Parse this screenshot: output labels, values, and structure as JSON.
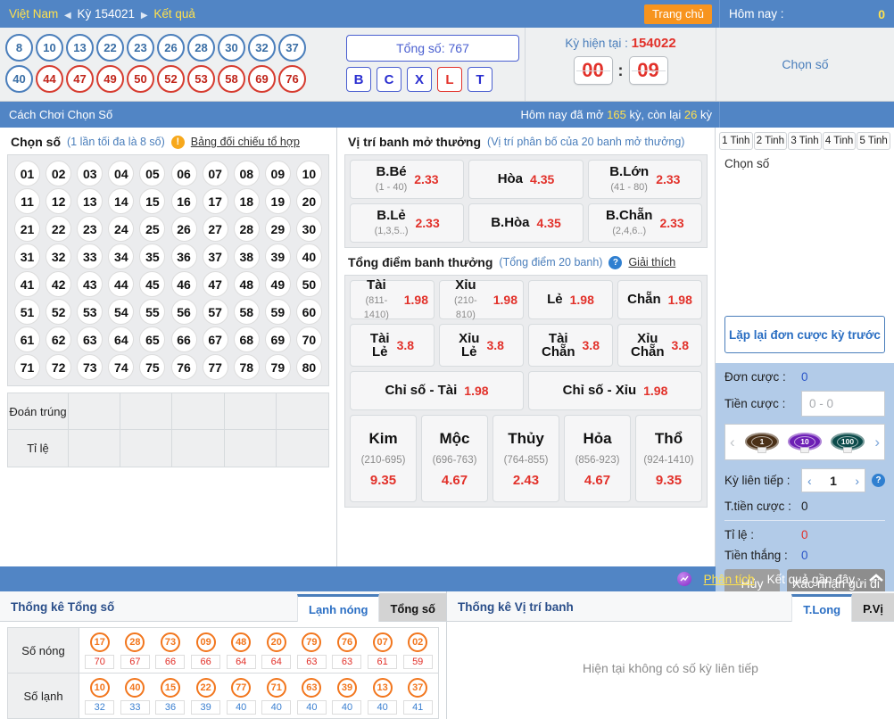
{
  "topbar": {
    "breadcrumb_country": "Việt Nam",
    "arrow_left": "◀",
    "breadcrumb_ky": "Kỳ 154021",
    "arrow_right": "▶",
    "breadcrumb_result": "Kết quả",
    "home_button": "Trang chủ",
    "today_label": "Hôm nay :",
    "today_value": "0"
  },
  "result": {
    "row1": [
      "8",
      "10",
      "13",
      "22",
      "23",
      "26",
      "28",
      "30",
      "32",
      "37"
    ],
    "row2": [
      "40",
      "44",
      "47",
      "49",
      "50",
      "52",
      "53",
      "58",
      "69",
      "76"
    ],
    "row2_red_from_index": 1,
    "total_label": "Tổng số: 767",
    "letters": [
      "B",
      "C",
      "X",
      "L",
      "T"
    ],
    "letter_red": "L",
    "ky_label": "Kỳ hiện tại :",
    "ky_value": "154022",
    "clock_minutes": "00",
    "clock_colon": ":",
    "clock_seconds": "09",
    "side_title": "Chọn số"
  },
  "subbar": {
    "how_to_play": "Cách Chơi Chọn Số",
    "opened_prefix": "Hôm nay đã mở",
    "opened_count": "165",
    "opened_mid": "kỳ, còn lại",
    "remain_count": "26",
    "opened_suffix": "kỳ"
  },
  "choose": {
    "title": "Chọn số",
    "subtitle": "(1 lần tối đa là 8 số)",
    "warn_icon": "!",
    "table_link": "Bảng đối chiếu tổ hợp",
    "numbers": [
      "01",
      "02",
      "03",
      "04",
      "05",
      "06",
      "07",
      "08",
      "09",
      "10",
      "11",
      "12",
      "13",
      "14",
      "15",
      "16",
      "17",
      "18",
      "19",
      "20",
      "21",
      "22",
      "23",
      "24",
      "25",
      "26",
      "27",
      "28",
      "29",
      "30",
      "31",
      "32",
      "33",
      "34",
      "35",
      "36",
      "37",
      "38",
      "39",
      "40",
      "41",
      "42",
      "43",
      "44",
      "45",
      "46",
      "47",
      "48",
      "49",
      "50",
      "51",
      "52",
      "53",
      "54",
      "55",
      "56",
      "57",
      "58",
      "59",
      "60",
      "61",
      "62",
      "63",
      "64",
      "65",
      "66",
      "67",
      "68",
      "69",
      "70",
      "71",
      "72",
      "73",
      "74",
      "75",
      "76",
      "77",
      "78",
      "79",
      "80"
    ],
    "ratio_row1_label": "Đoán trúng",
    "ratio_row2_label": "Tỉ lệ"
  },
  "position": {
    "title": "Vị trí banh mở thưởng",
    "subtitle": "(Vị trí phân bố của 20 banh mở thưởng)",
    "row1": [
      {
        "name": "B.Bé",
        "range": "(1 - 40)",
        "odds": "2.33"
      },
      {
        "name": "Hòa",
        "range": "",
        "odds": "4.35"
      },
      {
        "name": "B.Lớn",
        "range": "(41 - 80)",
        "odds": "2.33"
      }
    ],
    "row2": [
      {
        "name": "B.Lẻ",
        "range": "(1,3,5..)",
        "odds": "2.33"
      },
      {
        "name": "B.Hòa",
        "range": "",
        "odds": "4.35"
      },
      {
        "name": "B.Chẵn",
        "range": "(2,4,6..)",
        "odds": "2.33"
      }
    ]
  },
  "points": {
    "title": "Tổng điểm banh thưởng",
    "subtitle": "(Tổng điểm 20 banh)",
    "q_icon": "?",
    "explain_link": "Giải thích",
    "row1": [
      {
        "name": "Tài",
        "range": "(811-1410)",
        "odds": "1.98"
      },
      {
        "name": "Xỉu",
        "range": "(210-810)",
        "odds": "1.98"
      },
      {
        "name": "Lẻ",
        "range": "",
        "odds": "1.98"
      },
      {
        "name": "Chẵn",
        "range": "",
        "odds": "1.98"
      }
    ],
    "row2": [
      {
        "name": "Tài Lẻ",
        "range": "",
        "odds": "3.8"
      },
      {
        "name": "Xỉu Lẻ",
        "range": "",
        "odds": "3.8"
      },
      {
        "name": "Tài Chẵn",
        "range": "",
        "odds": "3.8"
      },
      {
        "name": "Xỉu Chẵn",
        "range": "",
        "odds": "3.8"
      }
    ],
    "row3": [
      {
        "name": "Chỉ số - Tài",
        "range": "",
        "odds": "1.98"
      },
      {
        "name": "Chỉ số - Xỉu",
        "range": "",
        "odds": "1.98"
      }
    ],
    "elements": [
      {
        "name": "Kim",
        "range": "(210-695)",
        "odds": "9.35"
      },
      {
        "name": "Mộc",
        "range": "(696-763)",
        "odds": "4.67"
      },
      {
        "name": "Thủy",
        "range": "(764-855)",
        "odds": "2.43"
      },
      {
        "name": "Hỏa",
        "range": "(856-923)",
        "odds": "4.67"
      },
      {
        "name": "Thổ",
        "range": "(924-1410)",
        "odds": "9.35"
      }
    ]
  },
  "sidebar": {
    "tinh_tabs": [
      "1 Tinh",
      "2 Tinh",
      "3 Tinh",
      "4 Tinh",
      "5 Tinh"
    ],
    "pick_placeholder": "Chọn số",
    "repeat_button": "Lặp lại đơn cược kỳ trước",
    "order_label": "Đơn cược :",
    "order_value": "0",
    "amount_label": "Tiền cược :",
    "amount_placeholder": "0 - 0",
    "chips": [
      {
        "value": "1",
        "color": "#4a3017"
      },
      {
        "value": "10",
        "color": "#6d1fb5"
      },
      {
        "value": "100",
        "color": "#0b4b4a"
      }
    ],
    "chev_left": "‹",
    "chev_right": "›",
    "consecutive_label": "Kỳ liên tiếp :",
    "consecutive_value": "1",
    "consecutive_help": "?",
    "total_amount_label": "T.tiền cược :",
    "total_amount_value": "0",
    "rate_label": "Tỉ lệ :",
    "rate_value": "0",
    "win_label": "Tiền thắng :",
    "win_value": "0",
    "cancel_button": "Hủy",
    "confirm_button": "Xác nhận gửi đi"
  },
  "bottombar": {
    "analysis_icon": "analysis-icon",
    "analysis_link": "Phân tích",
    "recent_results": "Kết quả gần đây",
    "caret": "⌃"
  },
  "stats_left": {
    "title": "Thống kê Tổng số",
    "tabs": [
      {
        "label": "Lạnh nóng",
        "active": true
      },
      {
        "label": "Tổng số",
        "active": false
      }
    ],
    "hot_label": "Số nóng",
    "cold_label": "Số lạnh",
    "hot_numbers": [
      "17",
      "28",
      "73",
      "09",
      "48",
      "20",
      "79",
      "76",
      "07",
      "02"
    ],
    "hot_counts": [
      "70",
      "67",
      "66",
      "66",
      "64",
      "64",
      "63",
      "63",
      "61",
      "59"
    ],
    "cold_numbers": [
      "10",
      "40",
      "15",
      "22",
      "77",
      "71",
      "63",
      "39",
      "13",
      "37"
    ],
    "cold_counts": [
      "32",
      "33",
      "36",
      "39",
      "40",
      "40",
      "40",
      "40",
      "40",
      "41"
    ]
  },
  "stats_right": {
    "title": "Thống kê Vị trí banh",
    "tabs": [
      {
        "label": "T.Long",
        "active": true
      },
      {
        "label": "P.Vị",
        "active": false
      }
    ],
    "empty_text": "Hiện tại không có số kỳ liên tiếp"
  },
  "colors": {
    "brand_blue": "#5185c5",
    "accent_orange": "#f7941e",
    "red": "#e2312a",
    "yellow": "#ffe14d",
    "hot_orange": "#f2761d"
  }
}
